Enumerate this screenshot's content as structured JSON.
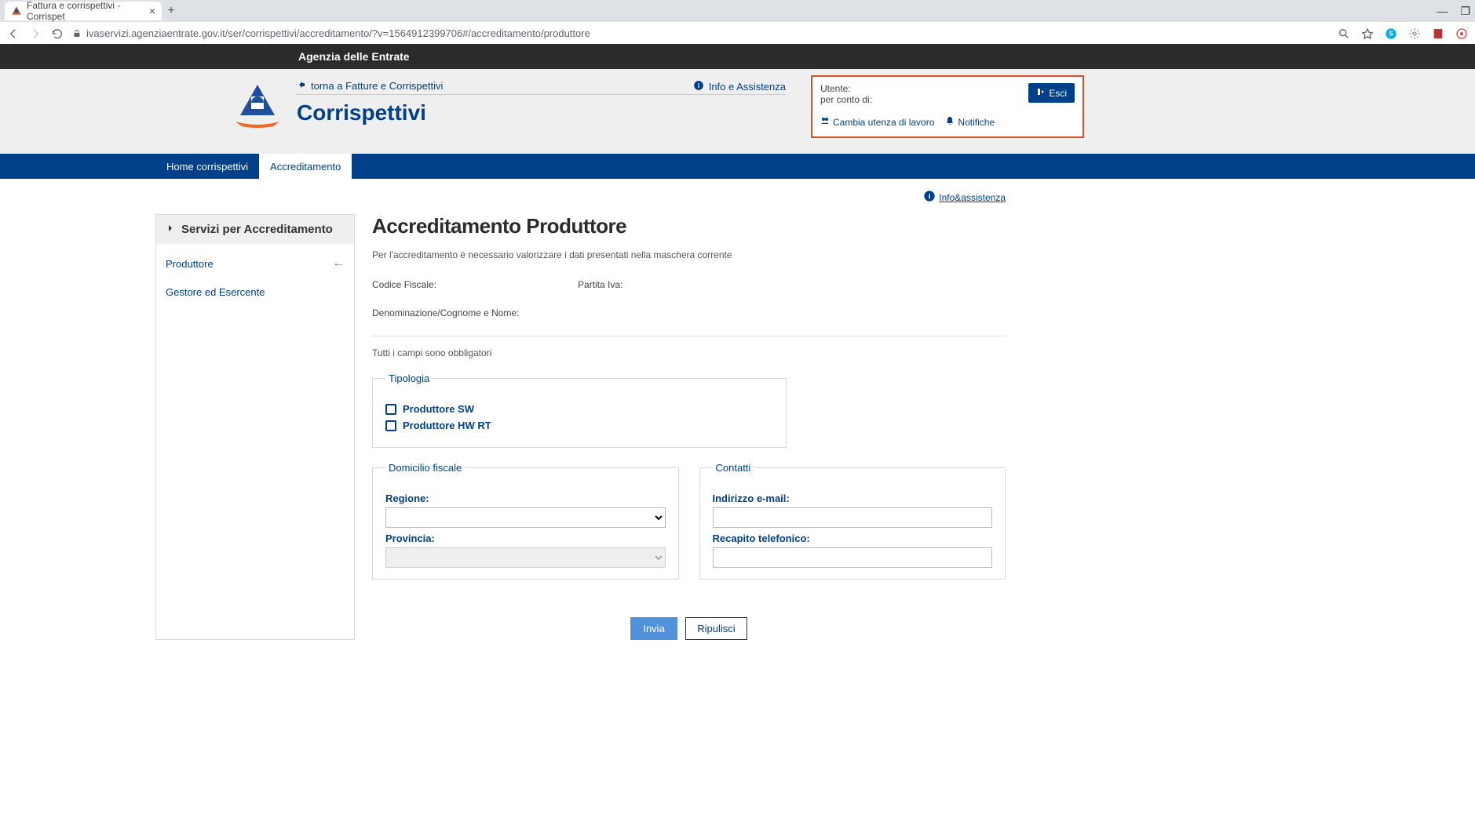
{
  "browser": {
    "tab_title": "Fattura e corrispettivi - Corrispet",
    "url": "ivaservizi.agenziaentrate.gov.it/ser/corrispettivi/accreditamento/?v=1564912399706#/accreditamento/produttore"
  },
  "header": {
    "agency": "Agenzia delle Entrate",
    "back_link": "torna a Fatture e Corrispettivi",
    "title": "Corrispettivi",
    "info_link": "Info e Assistenza"
  },
  "user_box": {
    "user_label": "Utente:",
    "on_behalf_label": "per conto di:",
    "exit": "Esci",
    "change_user": "Cambia utenza di lavoro",
    "notifications": "Notifiche"
  },
  "nav": {
    "tabs": [
      {
        "label": "Home corrispettivi",
        "active": false
      },
      {
        "label": "Accreditamento",
        "active": true
      }
    ]
  },
  "help_link": "Info&assistenza",
  "sidebar": {
    "title": "Servizi per Accreditamento",
    "items": [
      {
        "label": "Produttore",
        "active": true
      },
      {
        "label": "Gestore ed Esercente",
        "active": false
      }
    ]
  },
  "page": {
    "title": "Accreditamento Produttore",
    "description": "Per l'accreditamento è necessario valorizzare i dati presentati nella maschera corrente",
    "cf_label": "Codice Fiscale:",
    "piva_label": "Partita Iva:",
    "denom_label": "Denominazione/Cognome e Nome:",
    "mandatory": "Tutti i campi sono obbligatori",
    "tipologia": {
      "legend": "Tipologia",
      "opt1": "Produttore SW",
      "opt2": "Produttore HW RT"
    },
    "domicilio": {
      "legend": "Domicilio fiscale",
      "regione_label": "Regione:",
      "provincia_label": "Provincia:"
    },
    "contatti": {
      "legend": "Contatti",
      "email_label": "Indirizzo e-mail:",
      "tel_label": "Recapito telefonico:"
    },
    "buttons": {
      "submit": "Invia",
      "reset": "Ripulisci"
    }
  }
}
